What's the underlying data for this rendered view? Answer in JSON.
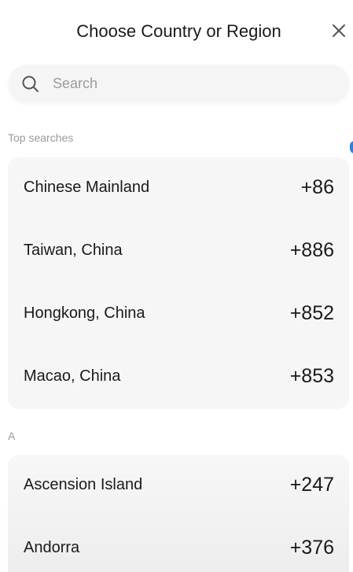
{
  "header": {
    "title": "Choose Country or Region",
    "close_icon": "close-icon"
  },
  "search": {
    "placeholder": "Search",
    "value": "",
    "icon": "search-icon"
  },
  "sections": {
    "top_label": "Top searches",
    "top": [
      {
        "name": "Chinese Mainland",
        "code": "+86"
      },
      {
        "name": "Taiwan, China",
        "code": "+886"
      },
      {
        "name": "Hongkong, China",
        "code": "+852"
      },
      {
        "name": "Macao, China",
        "code": "+853"
      }
    ],
    "a_label": "A",
    "a": [
      {
        "name": "Ascension Island",
        "code": "+247"
      },
      {
        "name": "Andorra",
        "code": "+376"
      }
    ]
  },
  "colors": {
    "accent": "#2f7fe0",
    "card_background": "#f6f6f6",
    "section_label": "#9a9a9a"
  }
}
